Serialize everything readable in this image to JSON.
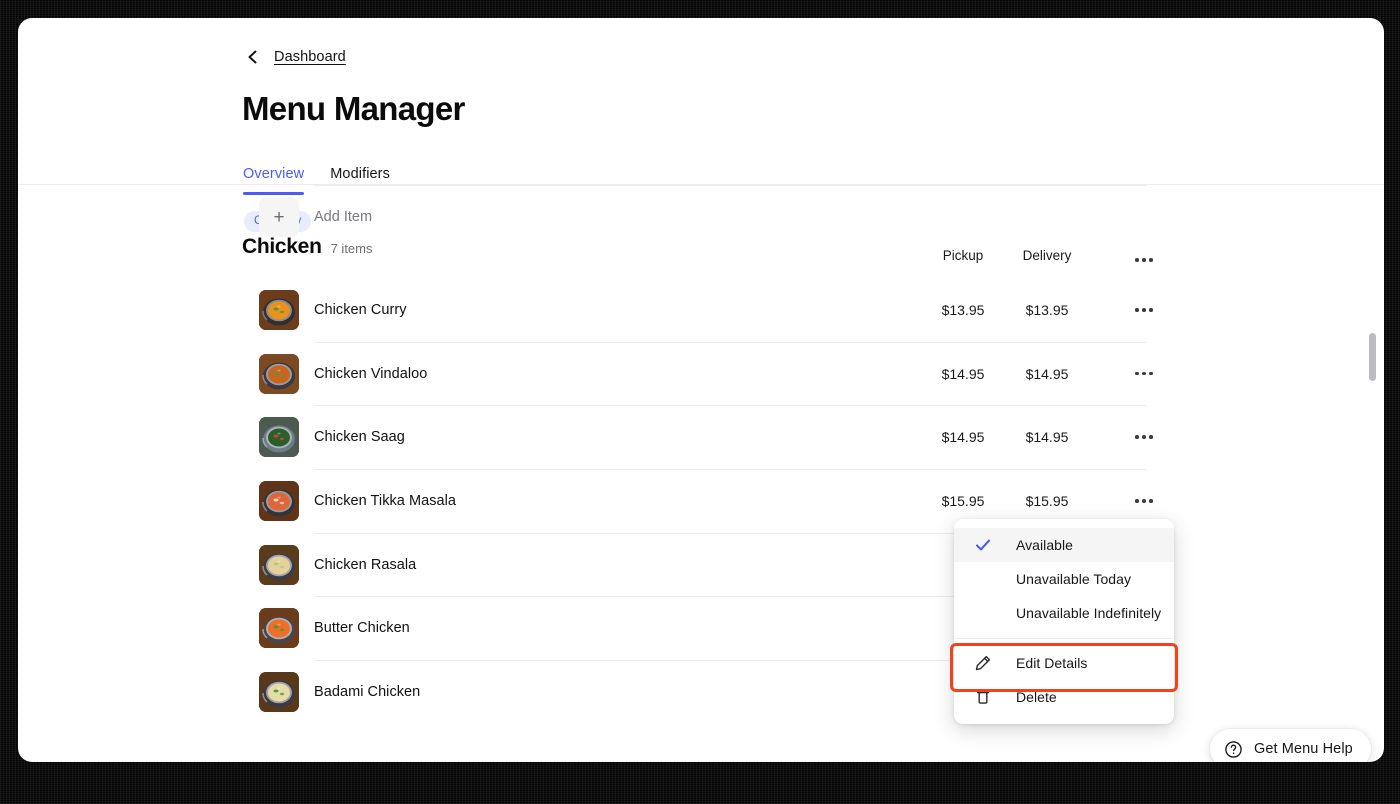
{
  "breadcrumb": {
    "label": "Dashboard",
    "back_icon": "chevron-left-icon"
  },
  "header": {
    "title": "Menu Manager"
  },
  "tabs": [
    {
      "label": "Overview",
      "active": true
    },
    {
      "label": "Modifiers",
      "active": false
    }
  ],
  "category": {
    "badge": "Category",
    "name": "Chicken",
    "count": "7 items",
    "columns": {
      "pickup": "Pickup",
      "delivery": "Delivery"
    },
    "overflow_icon": "more-horizontal-icon"
  },
  "items": [
    {
      "name": "Chicken Curry",
      "pickup": "$13.95",
      "delivery": "$13.95"
    },
    {
      "name": "Chicken Vindaloo",
      "pickup": "$14.95",
      "delivery": "$14.95"
    },
    {
      "name": "Chicken Saag",
      "pickup": "$14.95",
      "delivery": "$14.95"
    },
    {
      "name": "Chicken Tikka Masala",
      "pickup": "$15.95",
      "delivery": "$15.95"
    },
    {
      "name": "Chicken Rasala",
      "pickup": "$",
      "delivery": ""
    },
    {
      "name": "Butter Chicken",
      "pickup": "$",
      "delivery": ""
    },
    {
      "name": "Badami Chicken",
      "pickup": "$",
      "delivery": ""
    }
  ],
  "add_item": {
    "label": "Add Item",
    "icon": "plus-icon"
  },
  "context_menu": {
    "items": [
      {
        "label": "Available",
        "icon": "check-icon",
        "selected": true
      },
      {
        "label": "Unavailable Today",
        "icon": "",
        "selected": false
      },
      {
        "label": "Unavailable Indefinitely",
        "icon": "",
        "selected": false
      },
      {
        "label": "Edit Details",
        "icon": "pencil-icon",
        "selected": false,
        "highlighted": true
      },
      {
        "label": "Delete",
        "icon": "trash-icon",
        "selected": false
      }
    ]
  },
  "help_button": {
    "label": "Get Menu Help",
    "icon": "question-circle-icon"
  },
  "colors": {
    "accent": "#4b5cf5",
    "badge_bg": "#e9ebfe",
    "highlight_outline": "#f4401b",
    "text_primary": "#111114",
    "text_muted": "#79797f",
    "divider": "#ededee"
  }
}
